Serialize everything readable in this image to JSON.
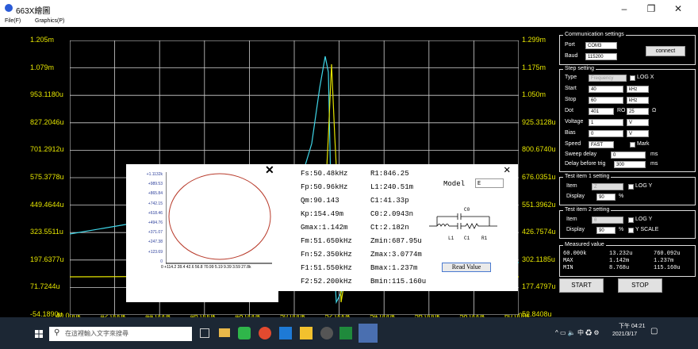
{
  "window": {
    "title": "663X繪圖",
    "minimize": "–",
    "restore": "❐",
    "close": "✕"
  },
  "menu": [
    "File(F)",
    "Graphics(P)"
  ],
  "left_axis": [
    "1.205m",
    "1.079m",
    "953.1180u",
    "827.2046u",
    "701.2912u",
    "575.3778u",
    "449.4644u",
    "323.5511u",
    "197.6377u",
    "71.7244u",
    "-54.1890u"
  ],
  "right_axis": [
    "1.299m",
    "1.175m",
    "1.050m",
    "925.3128u",
    "800.6740u",
    "676.0351u",
    "551.3962u",
    "426.7574u",
    "302.1185u",
    "177.4797u",
    "52.8408u"
  ],
  "x_axis": [
    "40.000k",
    "42.000k",
    "44.000k",
    "46.000k",
    "48.000k",
    "50.000k",
    "52.000k",
    "54.000k",
    "56.000k",
    "58.000k",
    "60.000k"
  ],
  "comm": {
    "title": "Communication settings",
    "port_label": "Port",
    "port": "COM3",
    "baud_label": "Baud",
    "baud": "115200",
    "connect": "connect"
  },
  "step": {
    "title": "Step setting",
    "type_label": "Type",
    "type": "Frequency",
    "logx": "LOG X",
    "start_label": "Start",
    "start": "40",
    "start_unit": "kHz",
    "stop_label": "Stop",
    "stop": "60",
    "stop_unit": "kHz",
    "dot_label": "Dot",
    "dot": "401",
    "ro_label": "RO",
    "ro": "25",
    "ohm": "Ω",
    "voltage_label": "Voltage",
    "voltage": "1",
    "voltage_unit": "V",
    "bias_label": "Bias",
    "bias": "0",
    "bias_unit": "V",
    "speed_label": "Speed",
    "speed": "FAST",
    "mark": "Mark",
    "sweep_label": "Sweep delay",
    "sweep": "0",
    "sweep_unit": "ms",
    "trig_label": "Delay before trig",
    "trig": "300",
    "trig_unit": "ms"
  },
  "item1": {
    "title": "Test item 1 setting",
    "item_label": "Item",
    "item": "Z",
    "logy": "LOG Y",
    "display_label": "Display",
    "display": "90",
    "pct": "%"
  },
  "item2": {
    "title": "Test item 2 setting",
    "item_label": "Item",
    "item": "θ",
    "logy": "LOG Y",
    "display_label": "Display",
    "display": "90",
    "pct": "%",
    "yscale": "Y SCALE"
  },
  "measured": {
    "title": "Measured value",
    "r1c1": "60.000k",
    "r1c2": "13.232u",
    "r1c3": "760.092u",
    "r2c1": "MAX",
    "r2c2": "1.142m",
    "r2c3": "1.237m",
    "r3c1": "MIN",
    "r3c2": "8.768u",
    "r3c3": "115.160u"
  },
  "buttons": {
    "start": "START",
    "stop": "STOP"
  },
  "polar": {
    "close": "✕",
    "y_ticks": [
      "+1.1132k",
      "+989.53",
      "+865.84",
      "+742.15",
      "+618.46",
      "+494.76",
      "+371.07",
      "+247.38",
      "+123.69",
      "0"
    ],
    "x_ticks": "0 +114.2 28.4 42.6 56.8 70.99 5.19 9.39 3.59 27.8k"
  },
  "results": {
    "close": "✕",
    "col1": [
      "Fs:50.48kHz",
      "Fp:50.96kHz",
      "Qm:90.143",
      "Kp:154.49m",
      "Gmax:1.142m",
      "Fm:51.650kHz",
      "Fn:52.350kHz",
      "F1:51.550kHz",
      "F2:52.200kHz"
    ],
    "col2": [
      "R1:846.25",
      "L1:240.51m",
      "C1:41.33p",
      "C0:2.0943n",
      "Ct:2.182n",
      "Zmin:687.95u",
      "Zmax:3.0774m",
      "Bmax:1.237m",
      "Bmin:115.160u"
    ],
    "model_label": "Model",
    "model": "E",
    "read": "Read Value",
    "c0": "C0",
    "l1": "L1",
    "c1": "C1",
    "r1": "R1"
  },
  "taskbar": {
    "search_placeholder": "在這裡輸入文字來搜尋",
    "time": "下午 04:21",
    "date": "2021/3/17"
  },
  "colors": {
    "cyan": "#3fd6e8",
    "yellow": "#e4e400"
  }
}
